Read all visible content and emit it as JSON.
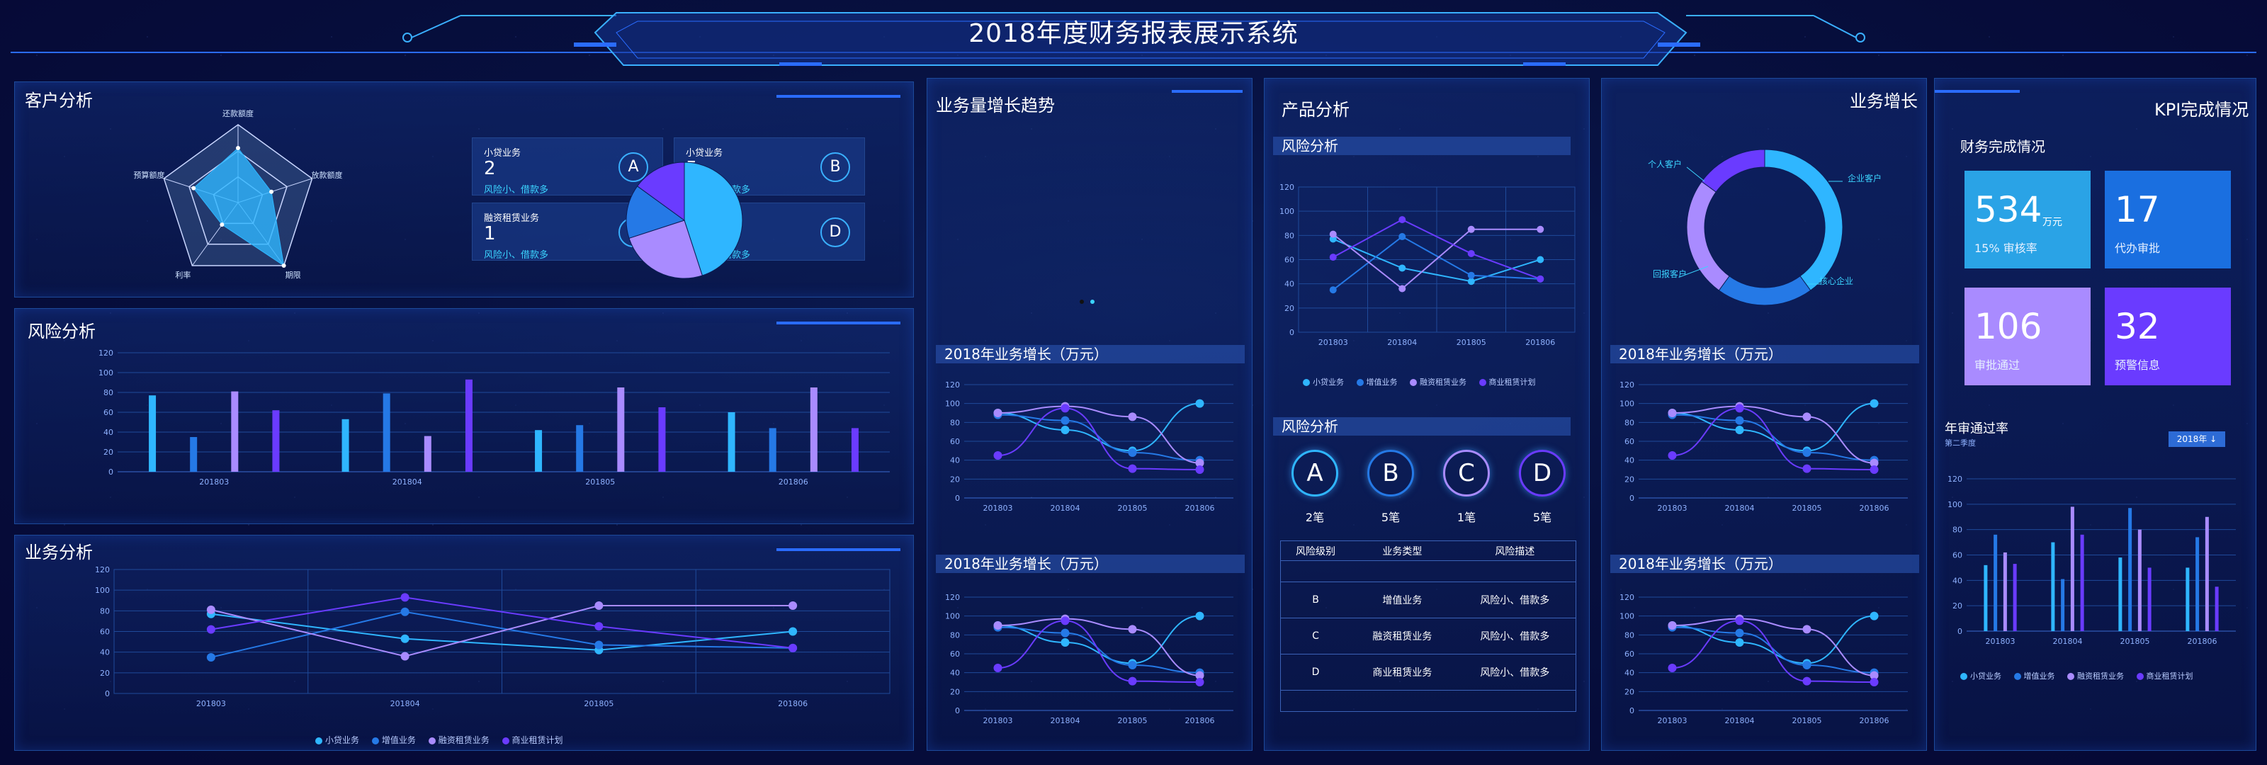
{
  "header": {
    "title": "2018年度财务报表展示系统"
  },
  "series": [
    "小贷业务",
    "增值业务",
    "融资租赁业务",
    "商业租赁计划"
  ],
  "seriesColors": [
    "#2fb6ff",
    "#2579e6",
    "#a98bff",
    "#6a3bff"
  ],
  "months": [
    "201803",
    "201804",
    "201805",
    "201806"
  ],
  "customer": {
    "title": "客户分析",
    "radar": {
      "labels": [
        "还款额度",
        "放款额度",
        "期限",
        "利率",
        "预算额度"
      ]
    },
    "cards": [
      {
        "title": "小贷业务",
        "num": "2",
        "desc": "风险小、借款多",
        "badge": "A"
      },
      {
        "title": "小贷业务",
        "num": "5",
        "desc": "风险小、借款多",
        "badge": "B"
      },
      {
        "title": "融资租赁业务",
        "num": "1",
        "desc": "风险小、借款多",
        "badge": "C"
      },
      {
        "title": "商业租赁业务",
        "num": "4",
        "desc": "风险小、借款多",
        "badge": "D"
      }
    ]
  },
  "risk_panel": {
    "title": "风险分析"
  },
  "business_panel": {
    "title": "业务分析"
  },
  "trend": {
    "title": "业务量增长趋势",
    "sub1": "2018年业务增长（万元）",
    "sub2": "2018年业务增长（万元）"
  },
  "product": {
    "title": "产品分析",
    "risk1": "风险分析",
    "risk2": "风险分析",
    "circles": [
      {
        "letter": "A",
        "count": "2笔"
      },
      {
        "letter": "B",
        "count": "5笔"
      },
      {
        "letter": "C",
        "count": "1笔"
      },
      {
        "letter": "D",
        "count": "5笔"
      }
    ],
    "table": {
      "headers": [
        "风险级别",
        "业务类型",
        "风险描述"
      ],
      "rows": [
        [
          "B",
          "增值业务",
          "风险小、借款多"
        ],
        [
          "C",
          "融资租赁业务",
          "风险小、借款多"
        ],
        [
          "D",
          "商业租赁业务",
          "风险小、借款多"
        ]
      ]
    }
  },
  "growth": {
    "title": "业务增长",
    "sub1": "2018年业务增长（万元）",
    "sub2": "2018年业务增长（万元）",
    "donut": {
      "labels": [
        "个人客户",
        "企业客户",
        "核心企业",
        "回报客户"
      ]
    }
  },
  "kpi": {
    "title": "KPI完成情况",
    "finance": "财务完成情况",
    "tiles": [
      {
        "value": "534",
        "unit": "万元",
        "label": "15% 审核率",
        "color": "#2aa3e6"
      },
      {
        "value": "17",
        "unit": "",
        "label": "代办审批",
        "color": "#1a6fe0"
      },
      {
        "value": "106",
        "unit": "",
        "label": "审批通过",
        "color": "#a98bff"
      },
      {
        "value": "32",
        "unit": "",
        "label": "预警信息",
        "color": "#6a3bff"
      }
    ],
    "annual": "年审通过率",
    "season": "第二季度",
    "year_btn": "2018年 ↓"
  },
  "chart_data": [
    {
      "type": "radar",
      "labels": [
        "还款额度",
        "放款额度",
        "期限",
        "利率",
        "预算额度"
      ],
      "values": [
        0.7,
        0.45,
        1.0,
        0.35,
        0.6
      ]
    },
    {
      "type": "pie",
      "values": [
        45,
        25,
        15,
        15
      ]
    },
    {
      "type": "bar",
      "categories": [
        "201803",
        "201804",
        "201805",
        "201806"
      ],
      "ylim": [
        0,
        120
      ],
      "series": [
        {
          "name": "小贷业务",
          "values": [
            77,
            53,
            42,
            60
          ]
        },
        {
          "name": "增值业务",
          "values": [
            35,
            79,
            47,
            44
          ]
        },
        {
          "name": "融资租赁业务",
          "values": [
            81,
            36,
            85,
            85
          ]
        },
        {
          "name": "商业租赁计划",
          "values": [
            62,
            93,
            65,
            44
          ]
        }
      ]
    },
    {
      "type": "line",
      "categories": [
        "201803",
        "201804",
        "201805",
        "201806"
      ],
      "ylim": [
        0,
        120
      ],
      "series": [
        {
          "name": "小贷业务",
          "values": [
            77,
            53,
            42,
            60
          ]
        },
        {
          "name": "增值业务",
          "values": [
            35,
            79,
            47,
            44
          ]
        },
        {
          "name": "融资租赁业务",
          "values": [
            81,
            36,
            85,
            85
          ]
        },
        {
          "name": "商业租赁计划",
          "values": [
            62,
            93,
            65,
            44
          ]
        }
      ]
    },
    {
      "type": "line",
      "categories": [
        "201803",
        "201804",
        "201805",
        "201806"
      ],
      "ylim": [
        0,
        120
      ],
      "series": [
        {
          "values": [
            90,
            72,
            50,
            100
          ]
        },
        {
          "values": [
            88,
            82,
            48,
            40
          ]
        },
        {
          "values": [
            90,
            97,
            86,
            37
          ]
        },
        {
          "values": [
            45,
            95,
            31,
            30
          ]
        }
      ]
    },
    {
      "type": "pie",
      "values": [
        40,
        20,
        25,
        15
      ]
    },
    {
      "type": "bar",
      "categories": [
        "201803",
        "201804",
        "201805",
        "201806"
      ],
      "ylim": [
        0,
        120
      ],
      "series": [
        {
          "values": [
            52,
            70,
            58,
            50
          ]
        },
        {
          "values": [
            76,
            41,
            97,
            74
          ]
        },
        {
          "values": [
            62,
            98,
            80,
            90
          ]
        },
        {
          "values": [
            53,
            76,
            50,
            35
          ]
        }
      ]
    }
  ]
}
